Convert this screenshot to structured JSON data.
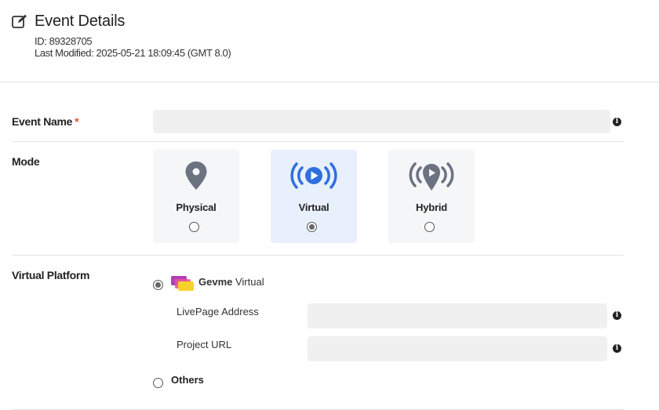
{
  "header": {
    "title": "Event Details",
    "id_text": "ID: 89328705",
    "last_modified": "Last Modified: 2025-05-21 18:09:45 (GMT 8.0)",
    "icon": "edit-icon"
  },
  "event_name": {
    "label": "Event Name",
    "required_mark": "*",
    "value": "",
    "info_icon": "info-icon"
  },
  "mode": {
    "label": "Mode",
    "options": [
      {
        "label": "Physical",
        "icon": "location-pin-icon",
        "selected": false
      },
      {
        "label": "Virtual",
        "icon": "broadcast-play-icon",
        "selected": true
      },
      {
        "label": "Hybrid",
        "icon": "broadcast-pin-icon",
        "selected": false
      }
    ],
    "accent": "#2f6fe0",
    "selected_bg": "#e8f0fe"
  },
  "virtual_platform": {
    "label": "Virtual Platform",
    "gevme": {
      "brand": "Gevme",
      "suffix": " Virtual",
      "selected": true,
      "livepage_label": "LivePage Address",
      "livepage_value": "",
      "project_url_label": "Project URL",
      "project_url_value": ""
    },
    "others": {
      "label": "Others",
      "selected": false
    }
  }
}
